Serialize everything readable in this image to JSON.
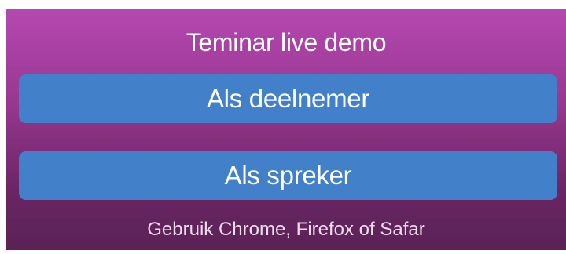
{
  "header": {
    "title": "Teminar live demo"
  },
  "actions": {
    "participant_label": "Als deelnemer",
    "speaker_label": "Als spreker"
  },
  "footer": {
    "note": "Gebruik Chrome, Firefox of Safar"
  },
  "colors": {
    "gradient_top": "#b548b2",
    "gradient_bottom": "#5a2255",
    "button": "#4281ca",
    "text": "#ffffff"
  }
}
